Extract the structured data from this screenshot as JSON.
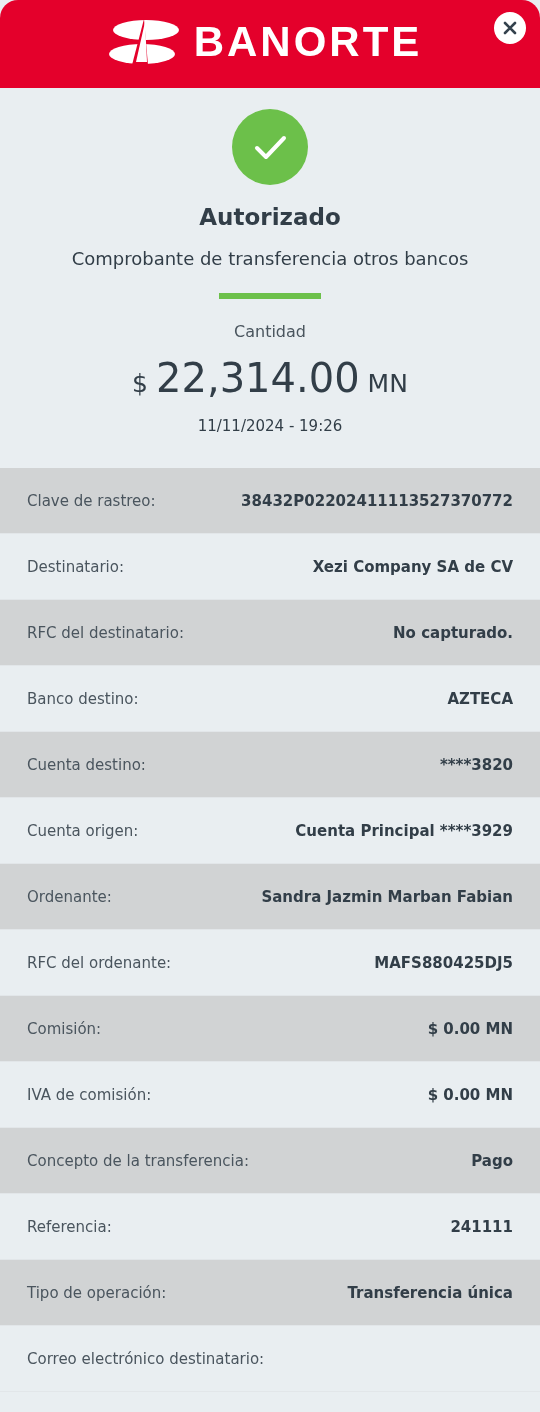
{
  "header": {
    "brand": "BANORTE"
  },
  "status": {
    "title": "Autorizado",
    "subtitle": "Comprobante de transferencia otros bancos"
  },
  "amount": {
    "label": "Cantidad",
    "currency": "$",
    "value": "22,314.00",
    "unit": "MN",
    "date": "11/11/2024 - 19:26"
  },
  "details": [
    {
      "label": "Clave de rastreo:",
      "value": "38432P02202411113527370772"
    },
    {
      "label": "Destinatario:",
      "value": "Xezi Company SA de CV"
    },
    {
      "label": "RFC del destinatario:",
      "value": "No capturado."
    },
    {
      "label": "Banco destino:",
      "value": "AZTECA"
    },
    {
      "label": "Cuenta destino:",
      "value": "****3820"
    },
    {
      "label": "Cuenta origen:",
      "value": "Cuenta Principal ****3929"
    },
    {
      "label": "Ordenante:",
      "value": "Sandra Jazmin Marban Fabian"
    },
    {
      "label": "RFC del ordenante:",
      "value": "MAFS880425DJ5"
    },
    {
      "label": "Comisión:",
      "value": "$ 0.00 MN"
    },
    {
      "label": "IVA de comisión:",
      "value": "$ 0.00 MN"
    },
    {
      "label": "Concepto de la transferencia:",
      "value": "Pago"
    },
    {
      "label": "Referencia:",
      "value": "241111"
    },
    {
      "label": "Tipo de operación:",
      "value": "Transferencia única"
    },
    {
      "label": "Correo electrónico destinatario:"
    }
  ]
}
